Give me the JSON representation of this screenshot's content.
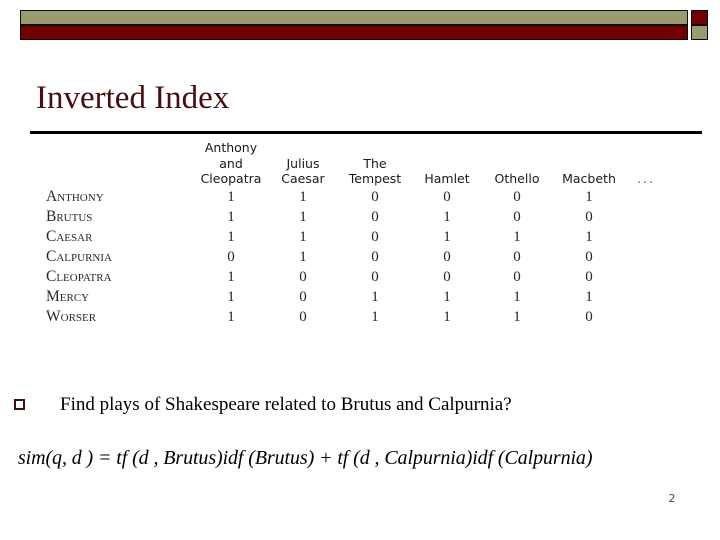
{
  "slide": {
    "title": "Inverted Index",
    "page_number": "2",
    "bullet_marker": "hollow-square",
    "bullet_text": "Find plays of Shakespeare related to Brutus and Calpurnia?",
    "formula": "sim(q, d ) = tf (d , Brutus)idf (Brutus) + tf (d , Calpurnia)idf (Calpurnia)"
  },
  "decoration": {
    "tan_color": "#9a9b6f",
    "maroon_color": "#730000",
    "title_color": "#4a0d0d",
    "outline_color": "#0d0d0d"
  },
  "matrix": {
    "corner_label": "",
    "columns": [
      "Anthony and Cleopatra",
      "Julius Caesar",
      "The Tempest",
      "Hamlet",
      "Othello",
      "Macbeth",
      "..."
    ],
    "column_lines": [
      [
        "Anthony",
        "and",
        "Cleopatra"
      ],
      [
        "Julius",
        "Caesar"
      ],
      [
        "The",
        "Tempest"
      ],
      [
        "Hamlet"
      ],
      [
        "Othello"
      ],
      [
        "Macbeth"
      ],
      [
        "..."
      ]
    ],
    "rows": [
      {
        "term": "Anthony",
        "values": [
          "1",
          "1",
          "0",
          "0",
          "0",
          "1"
        ]
      },
      {
        "term": "Brutus",
        "values": [
          "1",
          "1",
          "0",
          "1",
          "0",
          "0"
        ]
      },
      {
        "term": "Caesar",
        "values": [
          "1",
          "1",
          "0",
          "1",
          "1",
          "1"
        ]
      },
      {
        "term": "Calpurnia",
        "values": [
          "0",
          "1",
          "0",
          "0",
          "0",
          "0"
        ]
      },
      {
        "term": "Cleopatra",
        "values": [
          "1",
          "0",
          "0",
          "0",
          "0",
          "0"
        ]
      },
      {
        "term": "Mercy",
        "values": [
          "1",
          "0",
          "1",
          "1",
          "1",
          "1"
        ]
      },
      {
        "term": "Worser",
        "values": [
          "1",
          "0",
          "1",
          "1",
          "1",
          "0"
        ]
      }
    ]
  }
}
